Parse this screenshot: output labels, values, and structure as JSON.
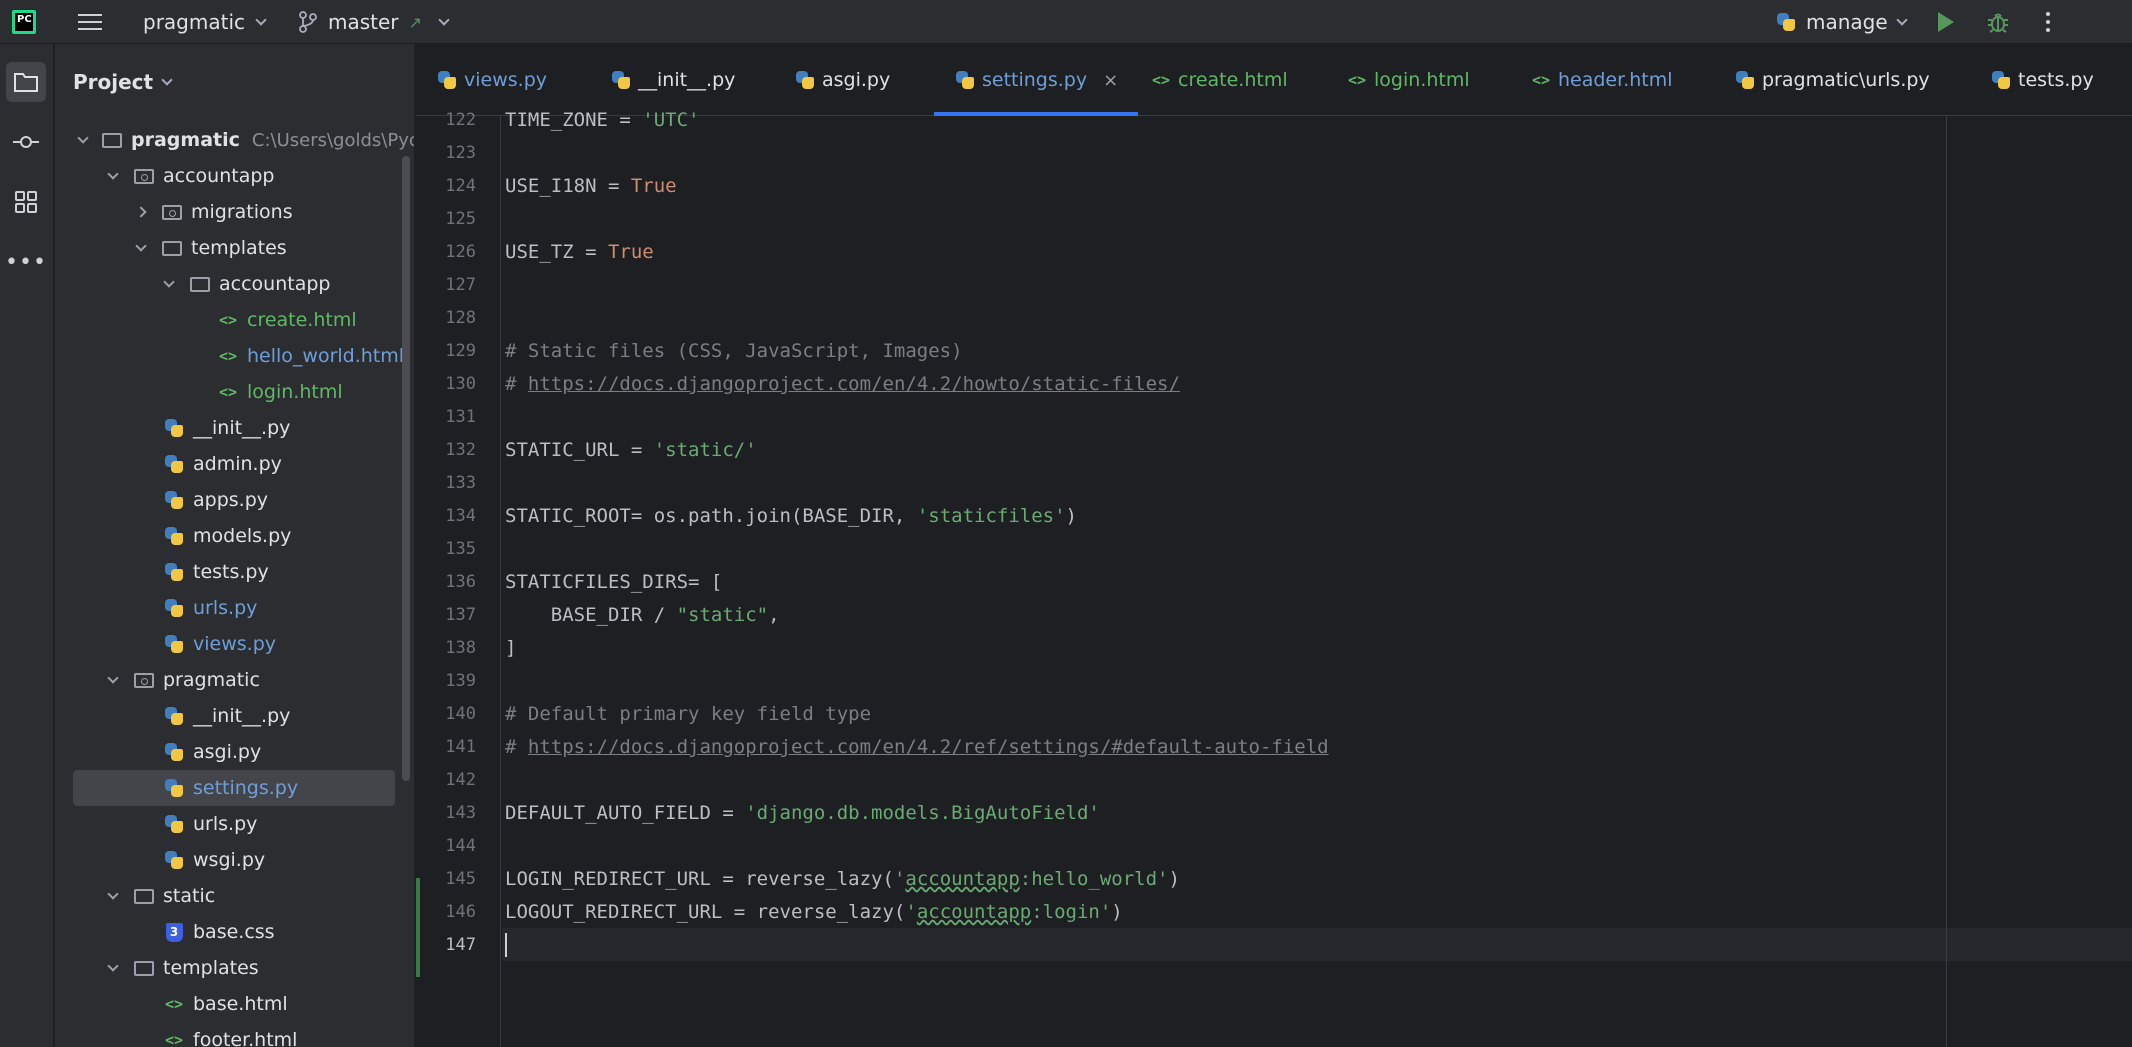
{
  "topbar": {
    "project_name": "pragmatic",
    "branch": "master",
    "run_config": "manage"
  },
  "toolstrip": {
    "items": [
      "project-tool",
      "commit-tool",
      "structure-tool",
      "more-tools"
    ]
  },
  "project_panel": {
    "title": "Project",
    "root_name": "pragmatic",
    "root_path": "C:\\Users\\golds\\Pyc",
    "items": [
      {
        "label": "accountapp"
      },
      {
        "label": "migrations"
      },
      {
        "label": "templates"
      },
      {
        "label": "accountapp"
      },
      {
        "label": "create.html"
      },
      {
        "label": "hello_world.html"
      },
      {
        "label": "login.html"
      },
      {
        "label": "__init__.py"
      },
      {
        "label": "admin.py"
      },
      {
        "label": "apps.py"
      },
      {
        "label": "models.py"
      },
      {
        "label": "tests.py"
      },
      {
        "label": "urls.py"
      },
      {
        "label": "views.py"
      },
      {
        "label": "pragmatic"
      },
      {
        "label": "__init__.py"
      },
      {
        "label": "asgi.py"
      },
      {
        "label": "settings.py"
      },
      {
        "label": "urls.py"
      },
      {
        "label": "wsgi.py"
      },
      {
        "label": "static"
      },
      {
        "label": "base.css"
      },
      {
        "label": "templates"
      },
      {
        "label": "base.html"
      },
      {
        "label": "footer.html"
      }
    ]
  },
  "tabs": [
    {
      "label": "views.py"
    },
    {
      "label": "__init__.py"
    },
    {
      "label": "asgi.py"
    },
    {
      "label": "settings.py",
      "close": "×"
    },
    {
      "label": "create.html"
    },
    {
      "label": "login.html"
    },
    {
      "label": "header.html"
    },
    {
      "label": "pragmatic\\urls.py"
    },
    {
      "label": "tests.py"
    }
  ],
  "editor": {
    "line_numbers": [
      "122",
      "123",
      "124",
      "125",
      "126",
      "127",
      "128",
      "129",
      "130",
      "131",
      "132",
      "133",
      "134",
      "135",
      "136",
      "137",
      "138",
      "139",
      "140",
      "141",
      "142",
      "143",
      "144",
      "145",
      "146",
      "147"
    ],
    "lines": {
      "l122_a": "TIME_ZONE = ",
      "l122_b": "'UTC'",
      "l124_a": "USE_I18N = ",
      "l124_b": "True",
      "l126_a": "USE_TZ = ",
      "l126_b": "True",
      "l129": "# Static files (CSS, JavaScript, Images)",
      "l130_a": "# ",
      "l130_b": "https://docs.djangoproject.com/en/4.2/howto/static-files/",
      "l132_a": "STATIC_URL = ",
      "l132_b": "'static/'",
      "l134_a": "STATIC_ROOT= os.path.join(BASE_DIR, ",
      "l134_b": "'staticfiles'",
      "l134_c": ")",
      "l136": "STATICFILES_DIRS= [",
      "l137_a": "    BASE_DIR / ",
      "l137_b": "\"static\"",
      "l137_c": ",",
      "l138": "]",
      "l140": "# Default primary key field type",
      "l141_a": "# ",
      "l141_b": "https://docs.djangoproject.com/en/4.2/ref/settings/#default-auto-field",
      "l143_a": "DEFAULT_AUTO_FIELD = ",
      "l143_b": "'django.db.models.BigAutoField'",
      "l145_a": "LOGIN_REDIRECT_URL = reverse_lazy(",
      "l145_b": "'",
      "l145_c": "accountapp",
      "l145_d": ":hello_world'",
      "l145_e": ")",
      "l146_a": "LOGOUT_REDIRECT_URL = reverse_lazy(",
      "l146_b": "'",
      "l146_c": "accountapp",
      "l146_d": ":login'",
      "l146_e": ")"
    }
  },
  "colors": {
    "accent": "#3574f0",
    "string": "#6aab73",
    "keyword": "#cf8e6d",
    "comment": "#7a7e85",
    "run": "#57965c",
    "debug": "#57965c"
  }
}
